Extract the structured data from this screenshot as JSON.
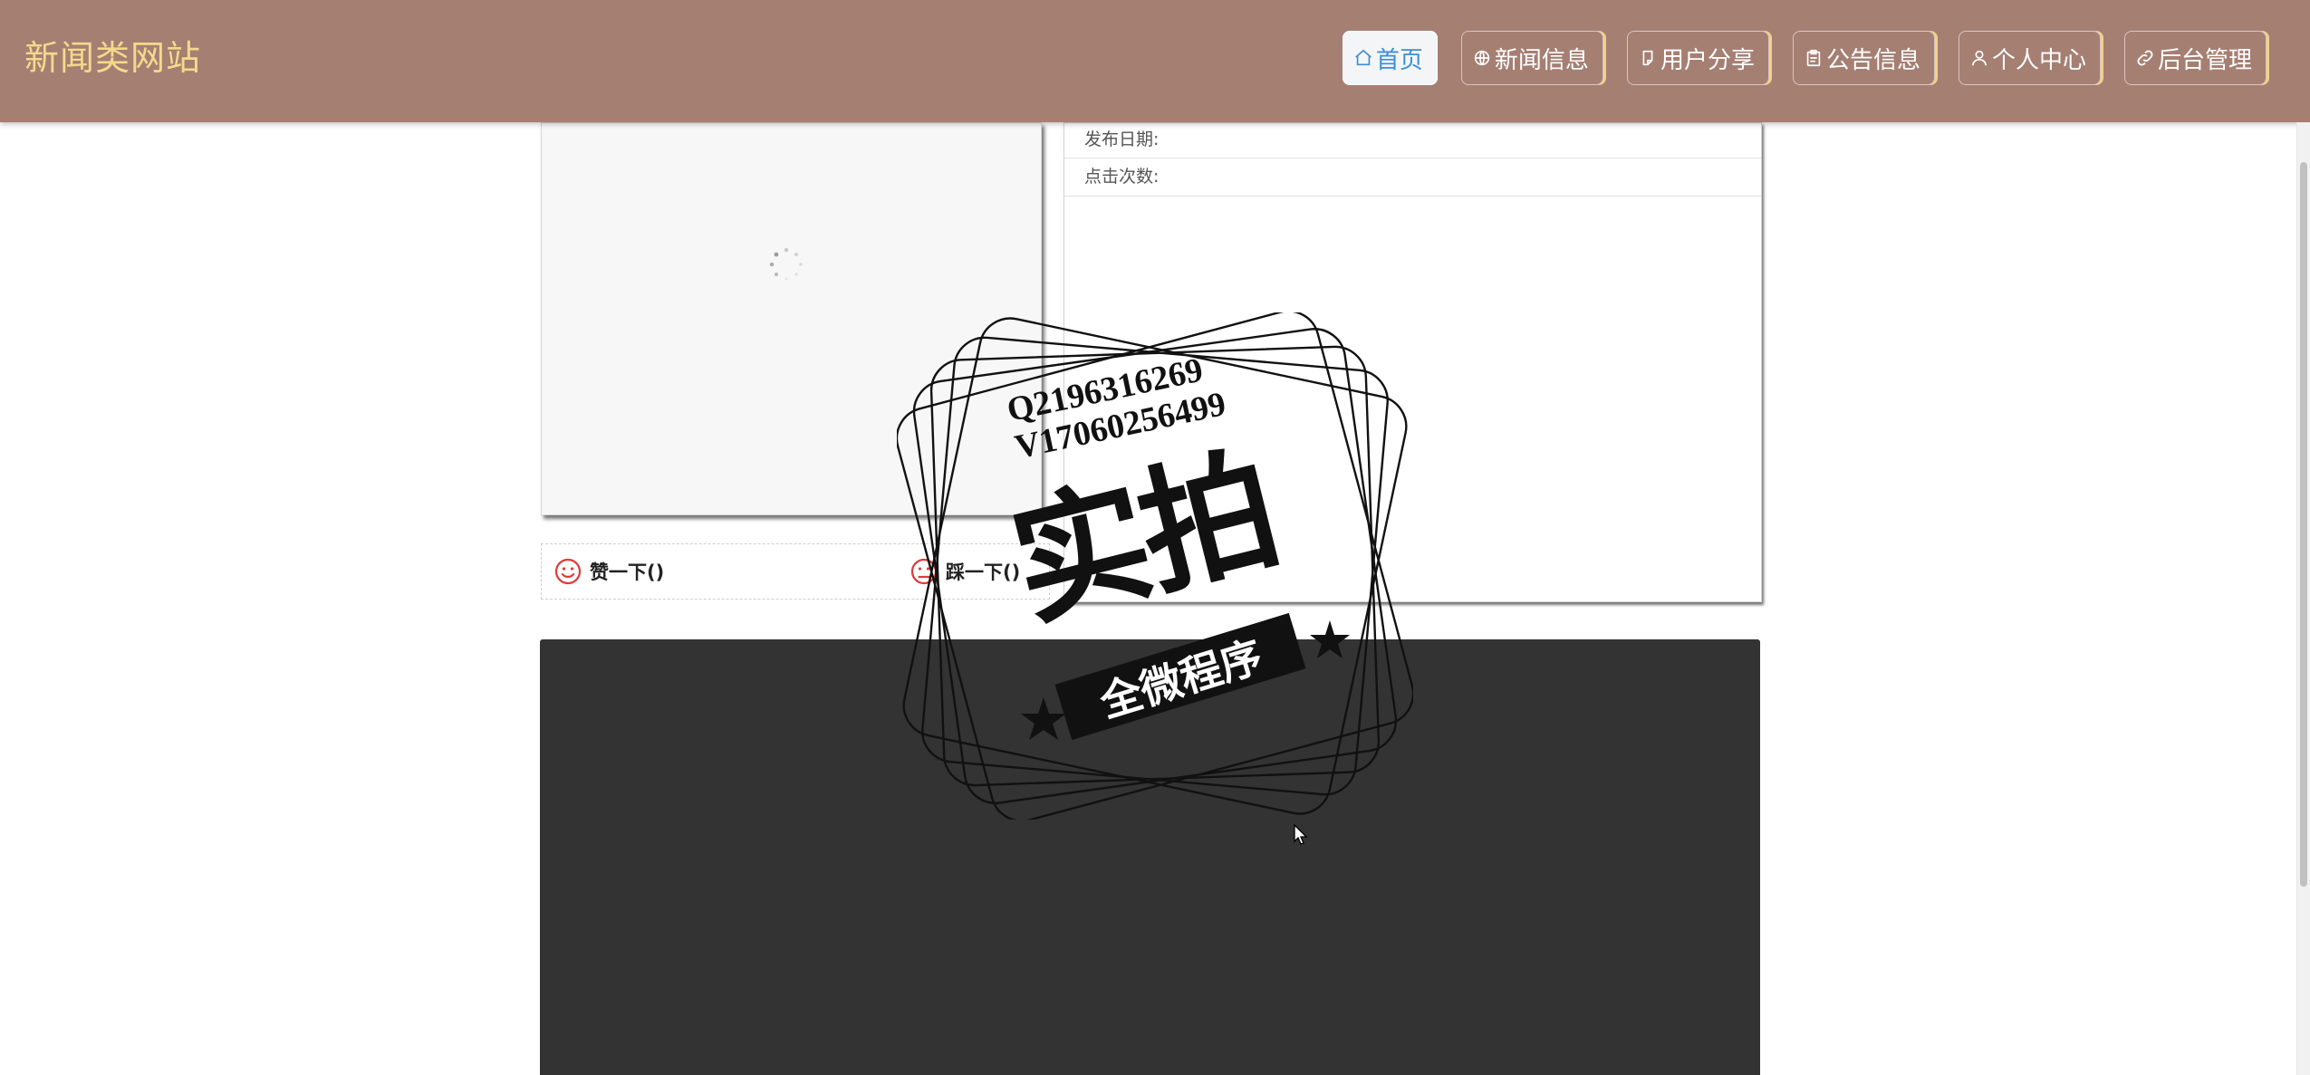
{
  "header": {
    "site_title": "新闻类网站",
    "background_color": "#a67f73",
    "title_color": "#f4d98c"
  },
  "nav": {
    "items": [
      {
        "label": "首页",
        "icon": "home-icon",
        "active": true
      },
      {
        "label": "新闻信息",
        "icon": "globe-icon",
        "active": false
      },
      {
        "label": "用户分享",
        "icon": "share-icon",
        "active": false
      },
      {
        "label": "公告信息",
        "icon": "clipboard-icon",
        "active": false
      },
      {
        "label": "个人中心",
        "icon": "user-icon",
        "active": false
      },
      {
        "label": "后台管理",
        "icon": "link-icon",
        "active": false
      }
    ]
  },
  "detail": {
    "publish_date_label": "发布日期:",
    "click_count_label": "点击次数:"
  },
  "votes": {
    "like_label": "赞一下()",
    "dislike_label": "踩一下()"
  },
  "watermark": {
    "qq": "Q2196316269",
    "wechat": "V17060256499",
    "big_text": "实拍",
    "ribbon_text": "全微程序"
  },
  "colors": {
    "dark_panel": "#333333",
    "active_nav_text": "#3b8fd8",
    "nav_accent": "#f0d28a",
    "vote_icon": "#e03a3a"
  }
}
